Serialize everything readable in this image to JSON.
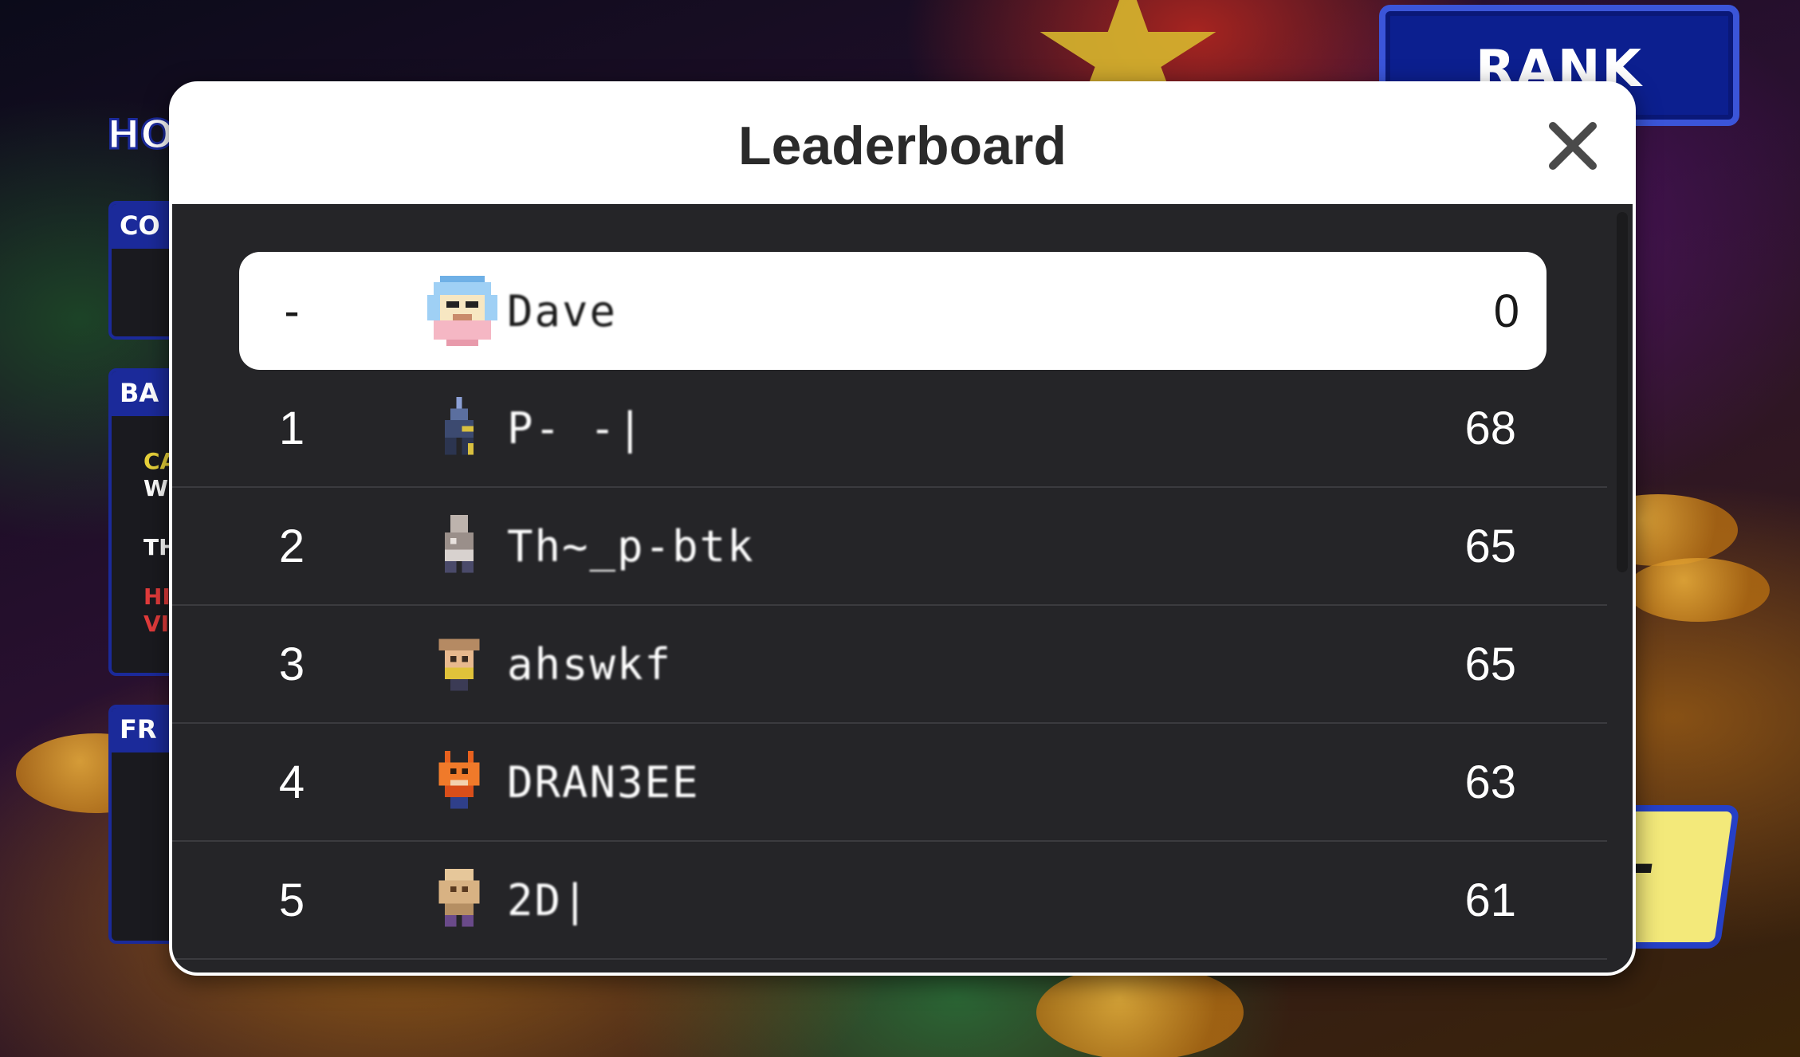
{
  "background": {
    "rank_button_label": "RANK",
    "home_label": "HO",
    "start_button_label": "RT",
    "side_panels": [
      {
        "head": "CO",
        "lines": []
      },
      {
        "head": "BA",
        "lines": [
          {
            "text": "CA",
            "color": "#e8d23a"
          },
          {
            "text": "WI",
            "color": "#ffffff"
          },
          {
            "text": "TH",
            "color": "#ffffff"
          },
          {
            "text": "HI",
            "color": "#e23b3b"
          },
          {
            "text": "VI",
            "color": "#e23b3b"
          }
        ]
      },
      {
        "head": "FR",
        "lines": []
      }
    ]
  },
  "leaderboard": {
    "title": "Leaderboard",
    "close_icon": "close-icon",
    "current_player": {
      "rank": "-",
      "name": "Dave",
      "score": "0",
      "avatar": "white-hooded-avatar"
    },
    "entries": [
      {
        "rank": "1",
        "name": "P- -|",
        "score": "68",
        "avatar": "dark-knight-avatar"
      },
      {
        "rank": "2",
        "name": "Th~_p-btk",
        "score": "65",
        "avatar": "grey-robot-avatar"
      },
      {
        "rank": "3",
        "name": "ahswkf",
        "score": "65",
        "avatar": "cowboy-avatar"
      },
      {
        "rank": "4",
        "name": "DRAN3EE",
        "score": "63",
        "avatar": "orange-fox-avatar"
      },
      {
        "rank": "5",
        "name": "2D|",
        "score": "61",
        "avatar": "tan-creature-avatar"
      }
    ]
  },
  "colors": {
    "modal_body": "#252528",
    "row_divider": "#3b3b3f",
    "self_row_bg": "#ffffff",
    "rank_button_blue": "#0c1f8f"
  }
}
